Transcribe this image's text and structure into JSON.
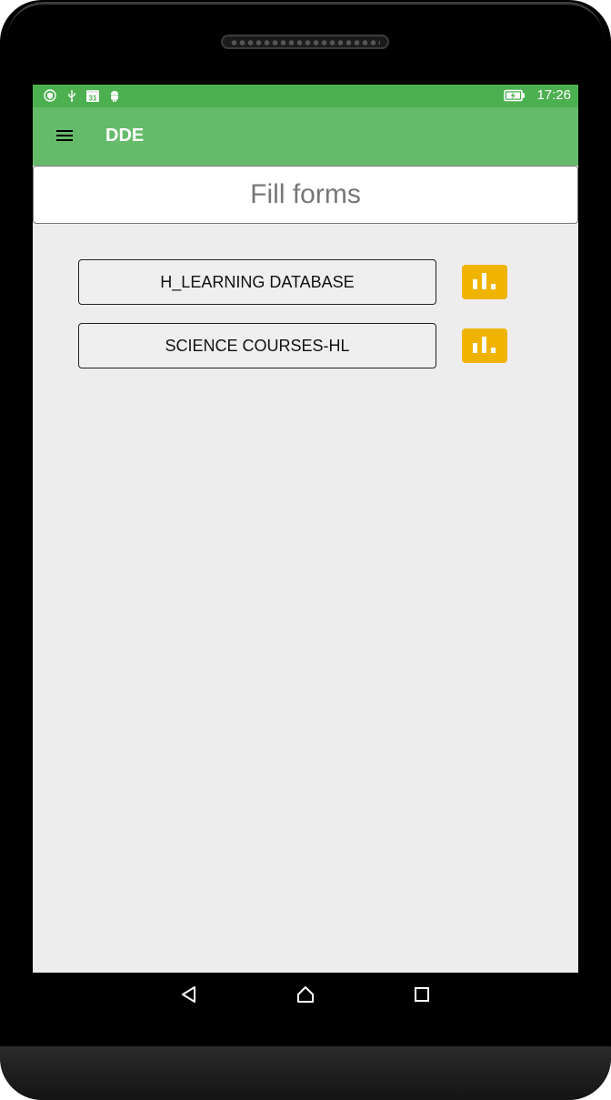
{
  "status_bar": {
    "time": "17:26",
    "notification_icons": [
      "vpn-shield-icon",
      "usb-icon",
      "calendar-icon",
      "android-debug-icon"
    ],
    "calendar_day": "31",
    "battery_icon": "battery-charging-icon"
  },
  "app_bar": {
    "menu_icon": "hamburger-menu-icon",
    "title": "DDE",
    "background": "#66bb6a",
    "status_background": "#4caf50"
  },
  "page": {
    "title": "Fill forms"
  },
  "forms": [
    {
      "label": "H_LEARNING DATABASE",
      "stats_icon": "bar-chart-icon"
    },
    {
      "label": "SCIENCE COURSES-HL",
      "stats_icon": "bar-chart-icon"
    }
  ],
  "accent_color": "#f0b400",
  "nav_bar": {
    "back_icon": "back-triangle-icon",
    "home_icon": "home-icon",
    "recents_icon": "recents-square-icon"
  }
}
